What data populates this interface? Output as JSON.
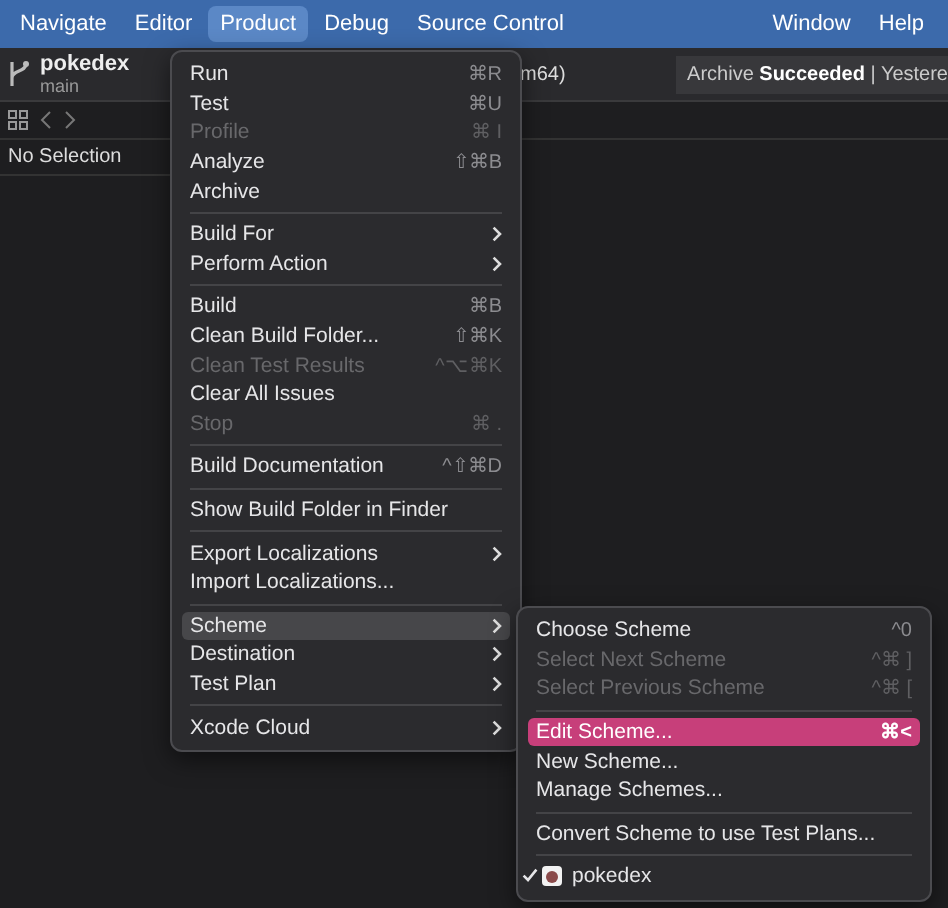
{
  "menubar": {
    "left": [
      {
        "label": "Navigate",
        "selected": false
      },
      {
        "label": "Editor",
        "selected": false
      },
      {
        "label": "Product",
        "selected": true
      },
      {
        "label": "Debug",
        "selected": false
      },
      {
        "label": "Source Control",
        "selected": false
      }
    ],
    "right": [
      {
        "label": "Window",
        "selected": false
      },
      {
        "label": "Help",
        "selected": false
      }
    ]
  },
  "toolbar": {
    "project": "pokedex",
    "branch": "main",
    "scheme_fragment": "m64)",
    "status": "Archive **Succeeded** | Yestere"
  },
  "navigator": {
    "empty_text": "No Selection"
  },
  "product_menu": [
    {
      "kind": "item",
      "label": "Run",
      "shortcut": "⌘R",
      "disabled": false,
      "submenu": false,
      "selected": false
    },
    {
      "kind": "item",
      "label": "Test",
      "shortcut": "⌘U",
      "disabled": false,
      "submenu": false,
      "selected": false
    },
    {
      "kind": "item",
      "label": "Profile",
      "shortcut": "⌘ I",
      "disabled": true,
      "submenu": false,
      "selected": false
    },
    {
      "kind": "item",
      "label": "Analyze",
      "shortcut": "⇧⌘B",
      "disabled": false,
      "submenu": false,
      "selected": false
    },
    {
      "kind": "item",
      "label": "Archive",
      "disabled": false,
      "submenu": false,
      "selected": false
    },
    {
      "kind": "separator"
    },
    {
      "kind": "item",
      "label": "Build For",
      "disabled": false,
      "submenu": true,
      "selected": false
    },
    {
      "kind": "item",
      "label": "Perform Action",
      "disabled": false,
      "submenu": true,
      "selected": false
    },
    {
      "kind": "separator"
    },
    {
      "kind": "item",
      "label": "Build",
      "shortcut": "⌘B",
      "disabled": false,
      "submenu": false,
      "selected": false
    },
    {
      "kind": "item",
      "label": "Clean Build Folder...",
      "shortcut": "⇧⌘K",
      "disabled": false,
      "submenu": false,
      "selected": false
    },
    {
      "kind": "item",
      "label": "Clean Test Results",
      "shortcut": "^⌥⌘K",
      "disabled": true,
      "submenu": false,
      "selected": false
    },
    {
      "kind": "item",
      "label": "Clear All Issues",
      "disabled": false,
      "submenu": false,
      "selected": false
    },
    {
      "kind": "item",
      "label": "Stop",
      "shortcut": "⌘ .",
      "disabled": true,
      "submenu": false,
      "selected": false
    },
    {
      "kind": "separator"
    },
    {
      "kind": "item",
      "label": "Build Documentation",
      "shortcut": "^⇧⌘D",
      "disabled": false,
      "submenu": false,
      "selected": false
    },
    {
      "kind": "separator"
    },
    {
      "kind": "item",
      "label": "Show Build Folder in Finder",
      "disabled": false,
      "submenu": false,
      "selected": false
    },
    {
      "kind": "separator"
    },
    {
      "kind": "item",
      "label": "Export Localizations",
      "disabled": false,
      "submenu": true,
      "selected": false
    },
    {
      "kind": "item",
      "label": "Import Localizations...",
      "disabled": false,
      "submenu": false,
      "selected": false
    },
    {
      "kind": "separator"
    },
    {
      "kind": "item",
      "label": "Scheme",
      "disabled": false,
      "submenu": true,
      "selected": true
    },
    {
      "kind": "item",
      "label": "Destination",
      "disabled": false,
      "submenu": true,
      "selected": false
    },
    {
      "kind": "item",
      "label": "Test Plan",
      "disabled": false,
      "submenu": true,
      "selected": false
    },
    {
      "kind": "separator"
    },
    {
      "kind": "item",
      "label": "Xcode Cloud",
      "disabled": false,
      "submenu": true,
      "selected": false
    }
  ],
  "scheme_menu": [
    {
      "kind": "item",
      "label": "Choose Scheme",
      "shortcut": "^0",
      "disabled": false,
      "selected": false
    },
    {
      "kind": "item",
      "label": "Select Next Scheme",
      "shortcut": "^⌘ ]",
      "disabled": true,
      "selected": false
    },
    {
      "kind": "item",
      "label": "Select Previous Scheme",
      "shortcut": "^⌘ [",
      "disabled": true,
      "selected": false
    },
    {
      "kind": "separator"
    },
    {
      "kind": "item",
      "label": "Edit Scheme...",
      "shortcut": "⌘<",
      "disabled": false,
      "selected": true
    },
    {
      "kind": "item",
      "label": "New Scheme...",
      "disabled": false,
      "selected": false
    },
    {
      "kind": "item",
      "label": "Manage Schemes...",
      "disabled": false,
      "selected": false
    },
    {
      "kind": "separator"
    },
    {
      "kind": "item",
      "label": "Convert Scheme to use Test Plans...",
      "disabled": false,
      "selected": false
    },
    {
      "kind": "separator"
    },
    {
      "kind": "scheme",
      "label": "pokedex",
      "checked": true,
      "selected": false
    }
  ]
}
